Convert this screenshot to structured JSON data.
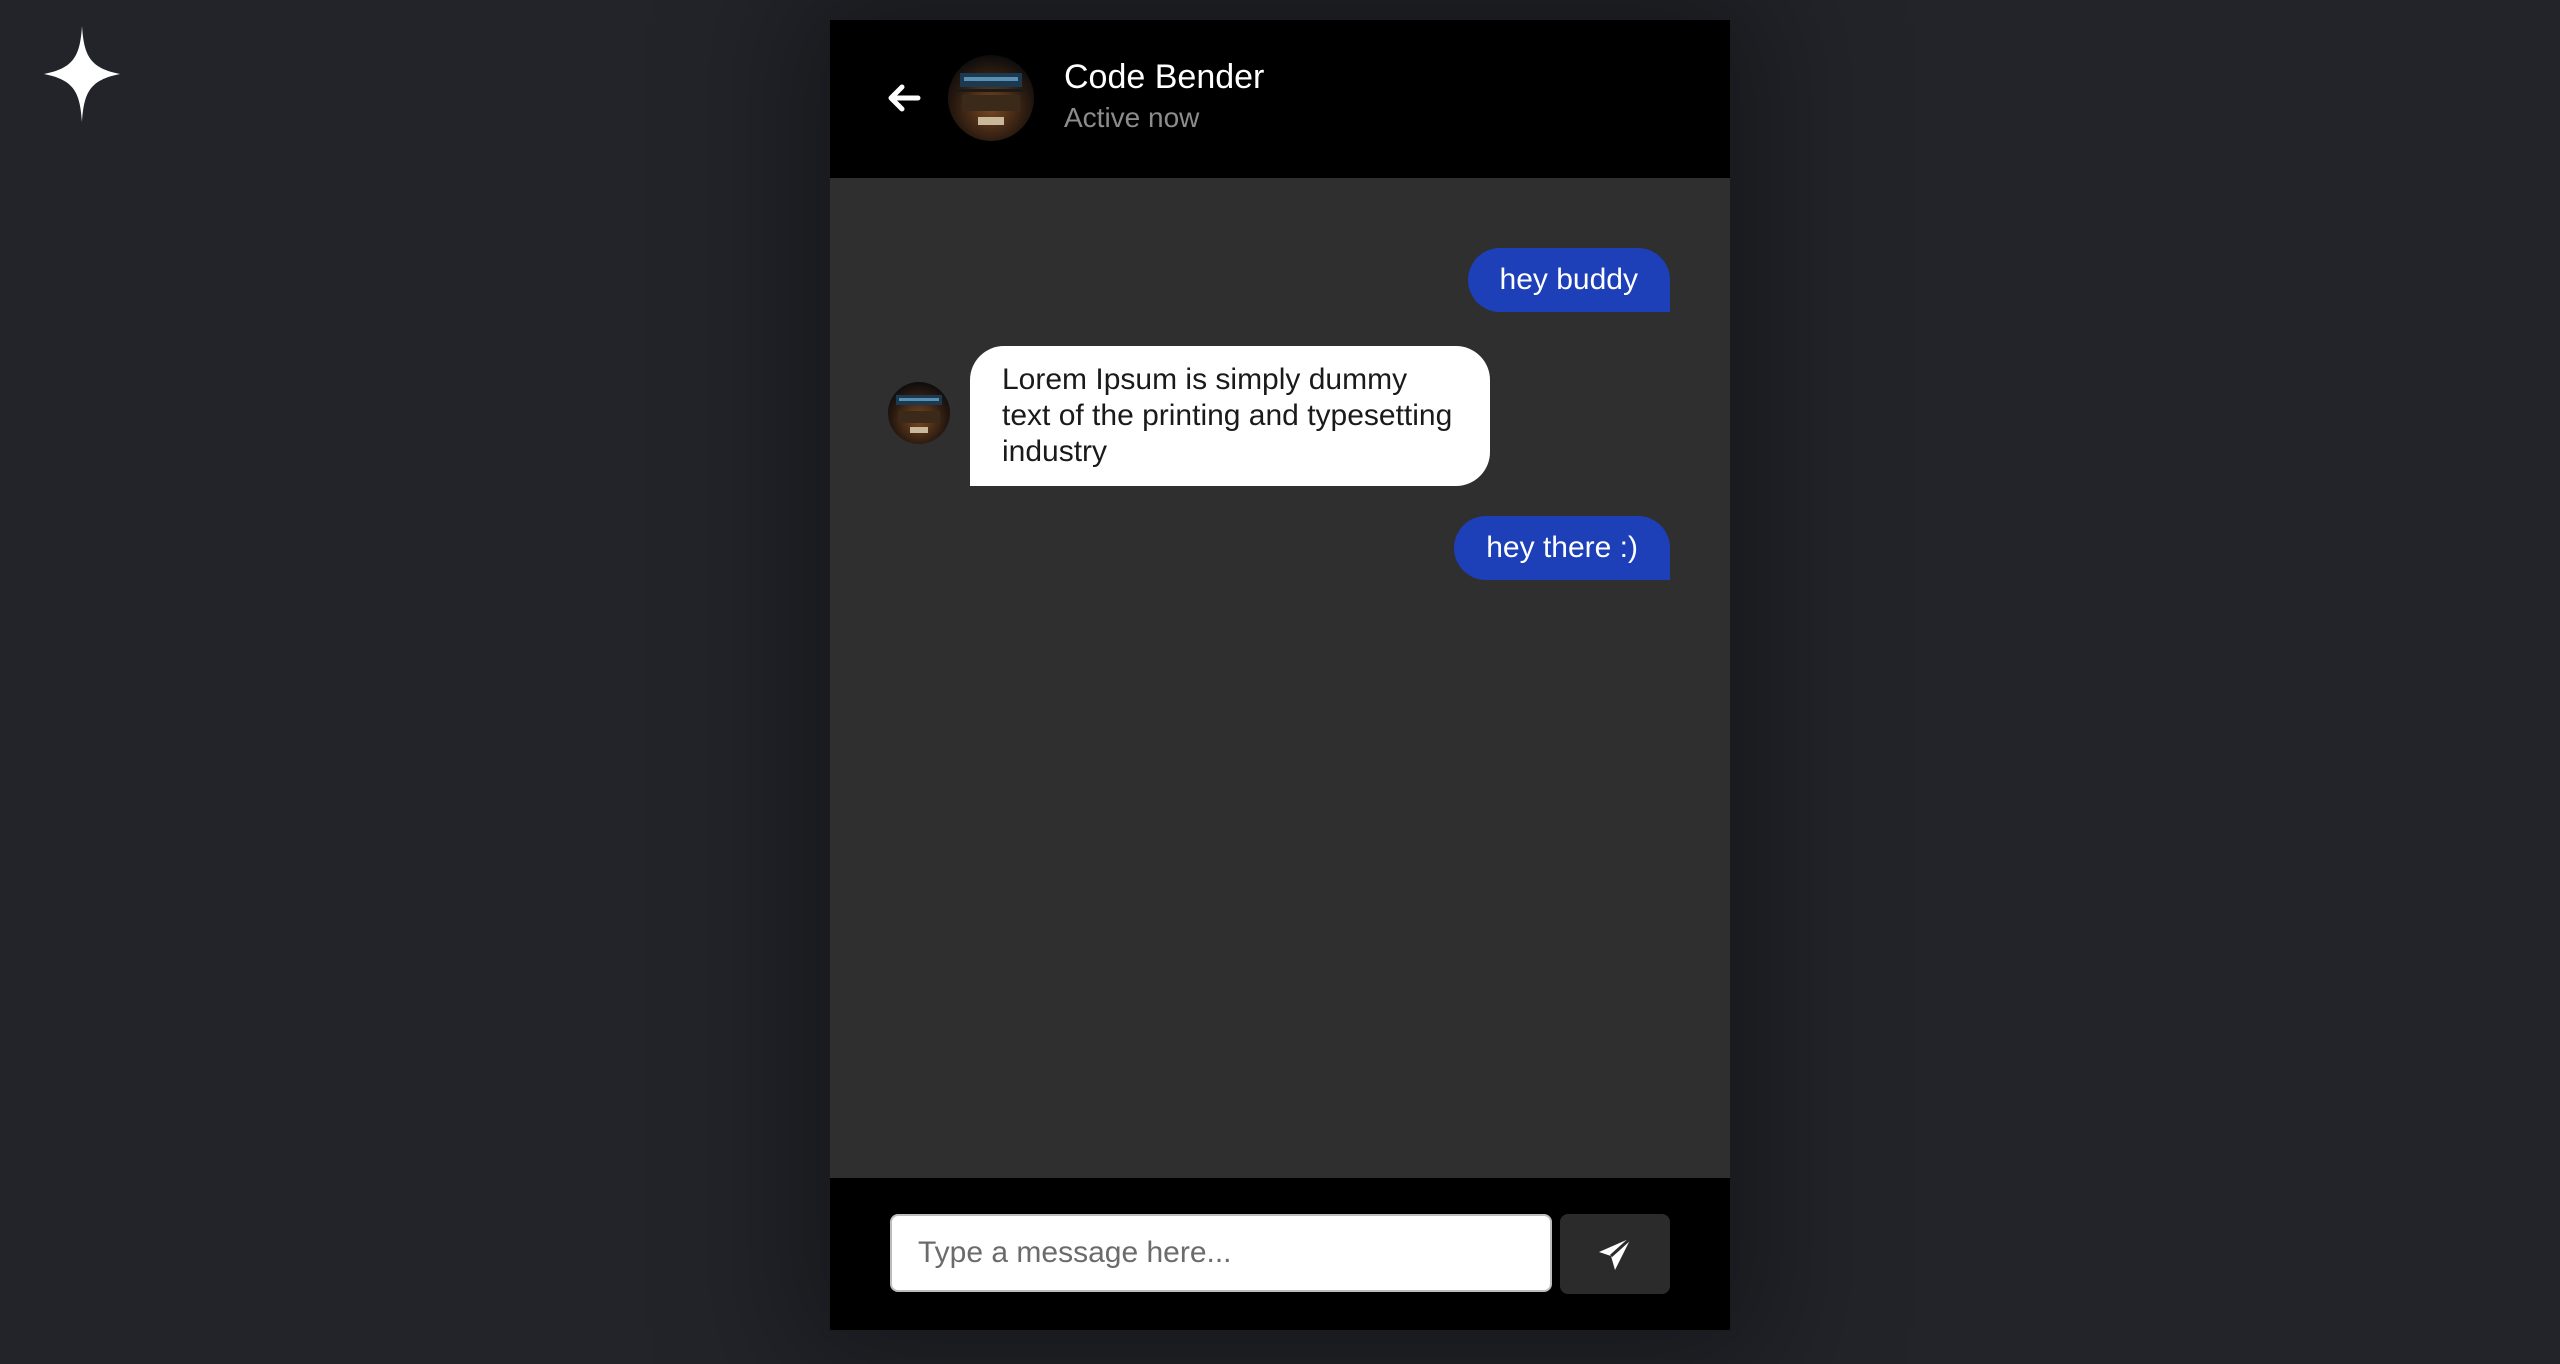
{
  "brand": {
    "logo_icon": "sparkle-icon"
  },
  "header": {
    "back_icon": "arrow-left-icon",
    "contact_name": "Code Bender",
    "status": "Active now"
  },
  "messages": [
    {
      "direction": "outgoing",
      "text": "hey buddy"
    },
    {
      "direction": "incoming",
      "text": "Lorem Ipsum is simply dummy text of the printing and typesetting industry"
    },
    {
      "direction": "outgoing",
      "text": "hey there :)"
    }
  ],
  "composer": {
    "placeholder": "Type a message here...",
    "send_icon": "paper-plane-icon"
  },
  "colors": {
    "page_background": "#23242a",
    "chat_background": "#2f2f2f",
    "header_background": "#000000",
    "outgoing_bubble": "#1d3fb8",
    "incoming_bubble": "#ffffff"
  }
}
